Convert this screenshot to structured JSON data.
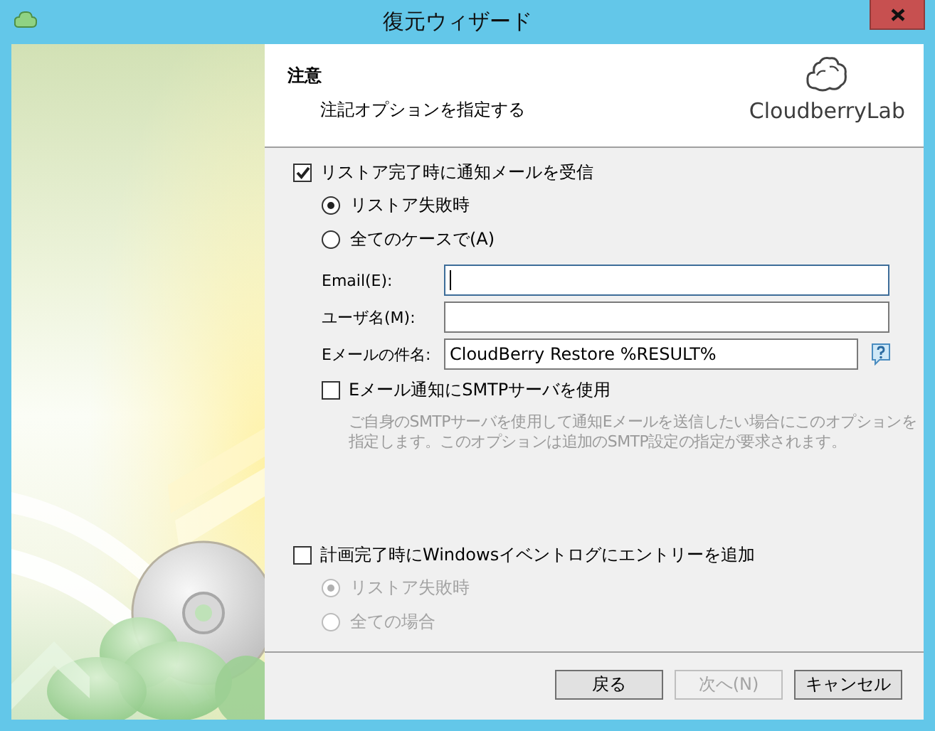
{
  "window": {
    "title": "復元ウィザード"
  },
  "header": {
    "title": "注意",
    "subtitle": "注記オプションを指定する",
    "logo": "CloudberryLab"
  },
  "notify": {
    "label": "リストア完了時に通知メールを受信",
    "checked": true,
    "options": [
      {
        "label": "リストア失敗時",
        "selected": true,
        "disabled": false
      },
      {
        "label": "全てのケースで(A)",
        "selected": false,
        "disabled": false
      }
    ],
    "fields": [
      {
        "label": "Email(E):",
        "focused": true,
        "help": false
      },
      {
        "label": "ユーザ名(M):",
        "focused": false,
        "help": false
      },
      {
        "label": "Eメールの件名:",
        "value": "CloudBerry Restore %RESULT%",
        "focused": false,
        "help": true
      }
    ]
  },
  "smtp": {
    "label": "Eメール通知にSMTPサーバを使用",
    "checked": false,
    "description": "ご自身のSMTPサーバを使用して通知Eメールを送信したい場合にこのオプションを指定します。このオプションは追加のSMTP設定の指定が要求されます。"
  },
  "eventlog": {
    "label": "計画完了時にWindowsイベントログにエントリーを追加",
    "checked": false,
    "options": [
      {
        "label": "リストア失敗時",
        "selected": true,
        "disabled": true
      },
      {
        "label": "全ての場合",
        "selected": false,
        "disabled": true
      }
    ]
  },
  "buttons": [
    {
      "label": "戻る",
      "disabled": false
    },
    {
      "label": "次へ(N)",
      "disabled": true
    },
    {
      "label": "キャンセル",
      "disabled": false
    }
  ]
}
